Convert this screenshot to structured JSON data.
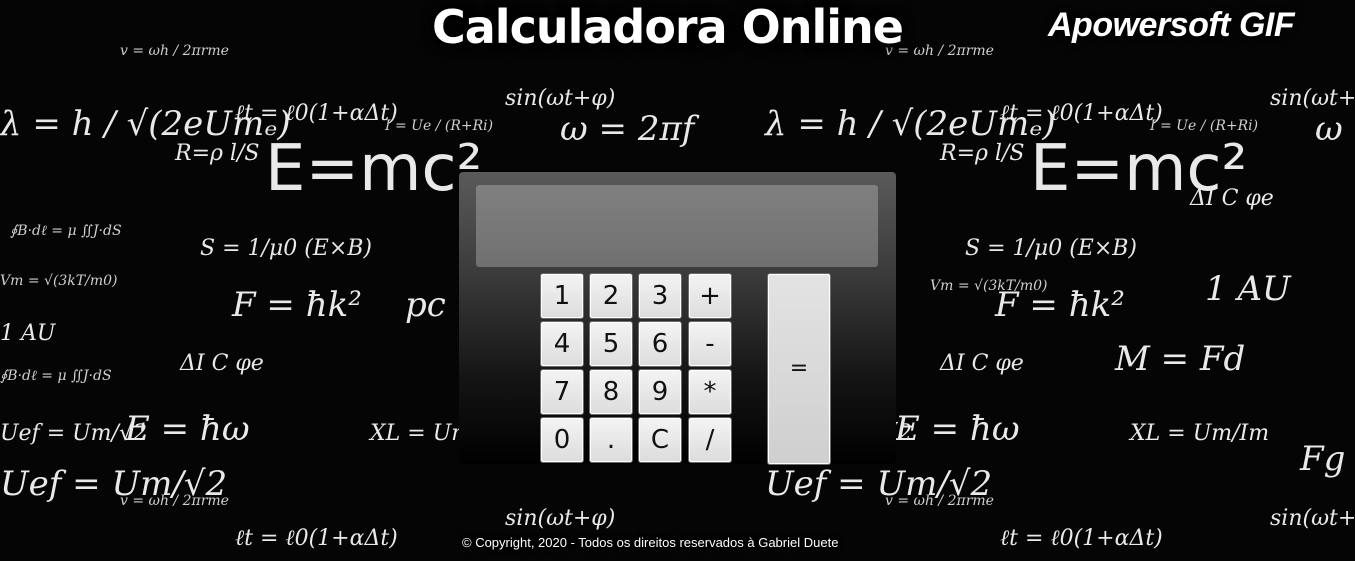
{
  "header": {
    "title": "Calculadora Online",
    "watermark": "Apowersoft GIF"
  },
  "calculator": {
    "display_value": "",
    "keys": {
      "one": "1",
      "two": "2",
      "three": "3",
      "plus": "+",
      "four": "4",
      "five": "5",
      "six": "6",
      "minus": "-",
      "seven": "7",
      "eight": "8",
      "nine": "9",
      "multiply": "*",
      "zero": "0",
      "dot": ".",
      "clear": "C",
      "divide": "/",
      "equals": "="
    }
  },
  "footer": {
    "copyright": "© Copyright, 2020 - Todos os direitos reservados à Gabriel Duete"
  },
  "background": {
    "formulas": [
      "E=mc²",
      "λ = h / √(2eUmₑ)",
      "R=ρ l/S",
      "ω = 2πf",
      "ℓt = ℓ0(1+αΔt)",
      "I = Ue / (R+Ri)",
      "F = ħk²",
      "pc =",
      "M = Fd",
      "Fg =",
      "E = ħω",
      "Uef = Um/√2",
      "v = ωh / 2πrme",
      "S = 1/μ0 (E×B)",
      "∮B·dℓ = μ ∬J·dS",
      "Vm = √(3kT/m0)",
      "sin(ωt+φ)",
      "1 AU",
      "ΔI C φe",
      "XL = Um/Im"
    ],
    "colors": {
      "chalk": "#e9e9e9",
      "board": "#050505"
    }
  }
}
